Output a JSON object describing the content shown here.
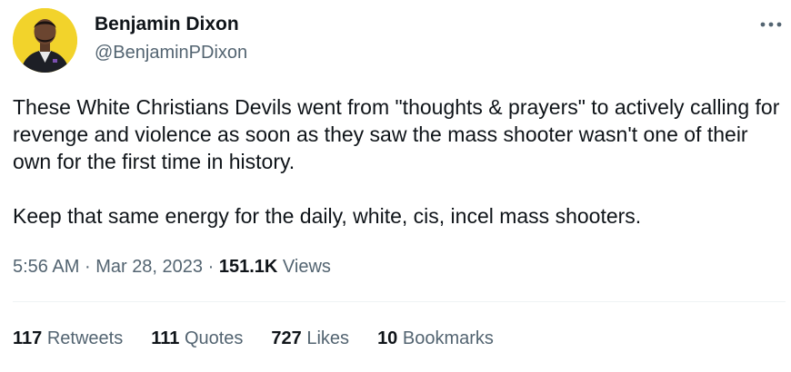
{
  "author": {
    "name": "Benjamin Dixon",
    "handle": "@BenjaminPDixon",
    "avatar_bg": "#f2d32b"
  },
  "more_icon": "more-horizontal-icon",
  "tweet": {
    "paragraph_1": "These White Christians Devils went from \"thoughts & prayers\" to actively calling for revenge and violence as soon as they saw the mass shooter wasn't one of their own for the first time in history.",
    "paragraph_2": "Keep that same energy for the daily, white, cis, incel  mass shooters."
  },
  "meta": {
    "time": "5:56 AM",
    "separator": "·",
    "date": "Mar 28, 2023",
    "views_count": "151.1K",
    "views_label": "Views"
  },
  "stats": {
    "retweets_count": "117",
    "retweets_label": "Retweets",
    "quotes_count": "111",
    "quotes_label": "Quotes",
    "likes_count": "727",
    "likes_label": "Likes",
    "bookmarks_count": "10",
    "bookmarks_label": "Bookmarks"
  },
  "colors": {
    "text": "#0f1419",
    "secondary": "#536471",
    "divider": "#eff3f4"
  }
}
